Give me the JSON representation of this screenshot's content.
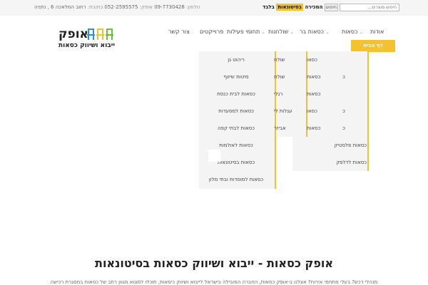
{
  "topbar": {
    "phone_label": "טלפון:",
    "phone": "09-7730428",
    "mobile_label": "אופק:",
    "mobile": "052-2595575",
    "address_label": "כתובת:",
    "address": "רחוב המלאכה 6 , נתניה",
    "message_pre": "המכירה",
    "message_highlight": "בסיטונאות",
    "message_post": "בלבד",
    "search_button": "חיפוש",
    "search_placeholder": "חיפוש מוצרים..."
  },
  "logo": {
    "name": "אופק",
    "tagline": "ייבוא ושיווק כסאות",
    "chair_colors": [
      "#2f8fd3",
      "#f2c230",
      "#6cbf3c"
    ]
  },
  "nav": {
    "items": [
      "אודות",
      "כסאות",
      "כסאות בר",
      "שולחנות",
      "תחומי פעילות",
      "פרוייקטים",
      "צור קשר"
    ],
    "home_button": "דף הבית"
  },
  "dropdowns": {
    "col_a": [
      "ריהוט גן",
      "מיטות שיזוף",
      "כסאות לבית כנסת",
      "כסאות למסעדות",
      "כסאות לבתי קפה",
      "כסאות לאולמות",
      "כסאות בסיטונאות",
      "כסאות למוסדות ובתי מלון"
    ],
    "col_b": [
      "שולח",
      "שולח",
      "רגלי",
      "עגלות לי",
      "אביזר"
    ],
    "col_d": [
      "כסאו",
      "כסאות",
      "כסאות",
      "כסאו",
      "כסאות"
    ],
    "col_d_edge": [
      "כ",
      "כ",
      "כ"
    ],
    "col_c": [
      "כסאות פלסטיק",
      "כסאות לדלפק"
    ]
  },
  "hero": {
    "title": "אופק כסאות - ייבוא ושיווק כסאות בסיטונאות",
    "subtitle": "מנהלי רכש? בעלי מתחמי אירוח? אצלנו ב-אופק כסאות, החברה המובילה בישראל לייבוא ושיווק כיסאות, תוכלו למצוא מגוון רחב של כסאות במסגרת רכישה"
  },
  "colors": {
    "accent": "#f2c230",
    "dropdown_bg": "#f4f4f4",
    "topbar_bg": "#f5f5f5"
  }
}
